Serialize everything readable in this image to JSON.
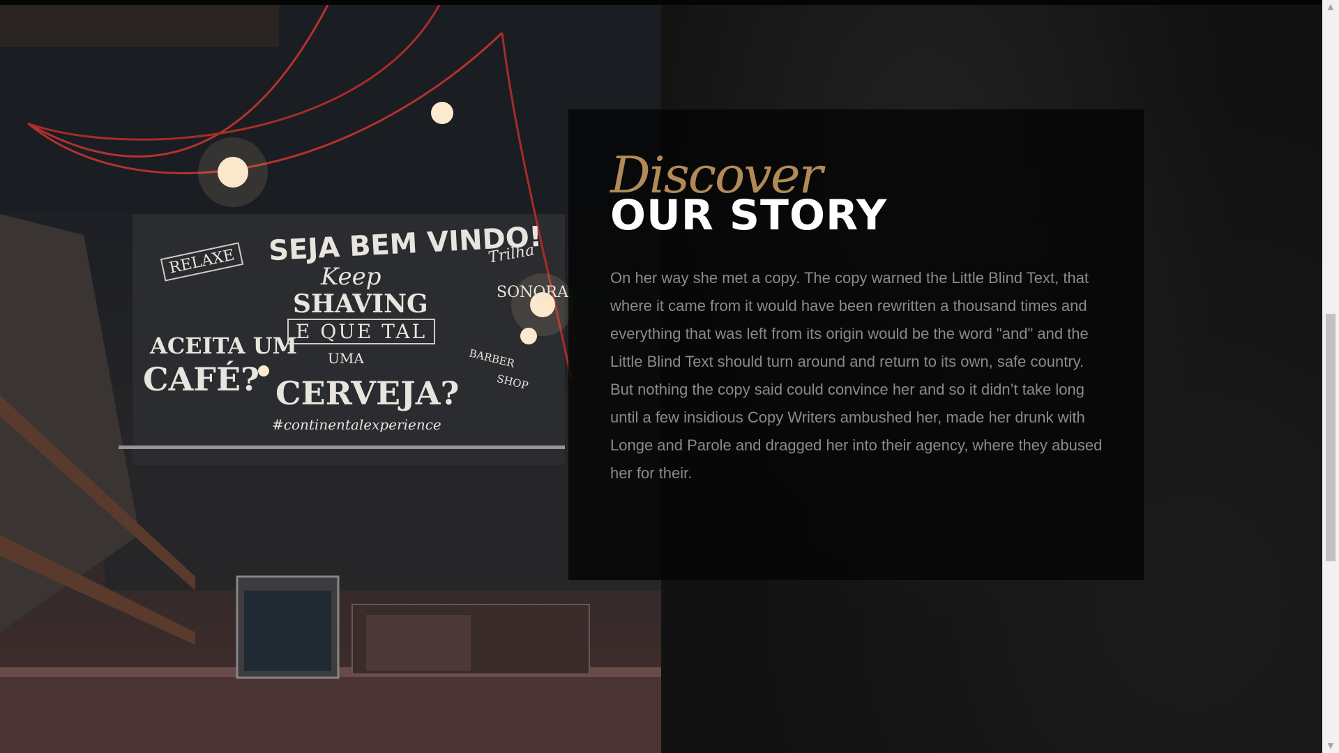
{
  "story": {
    "subheading": "Discover",
    "heading": "OUR STORY",
    "body": "On her way she met a copy. The copy warned the Little Blind Text, that where it came from it would have been rewritten a thousand times and everything that was left from its origin would be the word \"and\" and the Little Blind Text should turn around and return to its own, safe country. But nothing the copy said could convince her and so it didn’t take long until a few insidious Copy Writers ambushed her, made her drunk with Longe and Parole and dragged her into their agency, where they abused her for their."
  },
  "photo_signs": {
    "line1": "SEJA BEM VINDO!",
    "line2": "Keep",
    "line3": "SHAVING",
    "line4": "E QUE TAL",
    "line5": "UMA",
    "line6": "CERVEJA?",
    "hashtag": "#continentalexperience",
    "left1": "RELAXE",
    "left2": "ACEITA UM",
    "left3": "CAFÉ?",
    "right1": "Trilha",
    "right2": "SONORA",
    "barber1": "BARBER",
    "barber2": "SHOP"
  },
  "scrollbar": {
    "up_icon": "▲",
    "down_icon": "▼"
  },
  "colors": {
    "accent": "#b28a57",
    "heading": "#ffffff",
    "body": "#8a8a8a"
  }
}
